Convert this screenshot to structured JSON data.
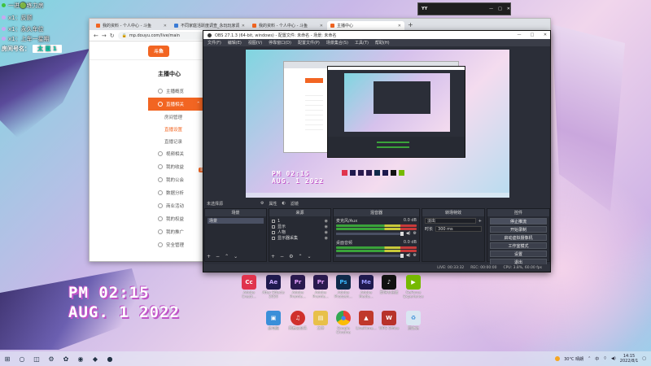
{
  "overlay": {
    "lines": [
      {
        "text": "一进🟢练力房",
        "dot": "#3fc23f"
      },
      {
        "text": "x1：反顾",
        "dot": ""
      },
      {
        "text": "x1：永久车位",
        "dot": ""
      },
      {
        "text": "x1：上车一星期",
        "dot": ""
      }
    ],
    "room_label": "房间号名：",
    "room_value": "太 鼠 1"
  },
  "stamp": {
    "time": "PM 02:15",
    "date": "AUG. 1 2022"
  },
  "browser": {
    "tabs": [
      {
        "label": "我的资料 - 个人中心 - 斗鱼",
        "close": "✕"
      },
      {
        "label": "不同家庭活跃度调查_永玩玩家调查",
        "close": "✕"
      },
      {
        "label": "我的资料 - 个人中心 - 斗鱼",
        "close": "✕"
      },
      {
        "label": "主播中心",
        "close": "✕"
      }
    ],
    "new_tab": "+",
    "url": "mp.douyu.com/live/main",
    "logo": "斗鱼",
    "home_tab": "首页",
    "sidebar_title": "主播中心",
    "sidebar": [
      {
        "label": "主播概览",
        "active": false
      },
      {
        "label": "直播相关",
        "active": true
      }
    ],
    "sub_items": [
      {
        "label": "房间管理",
        "active": false
      },
      {
        "label": "直播设置",
        "active": true
      },
      {
        "label": "直播记录",
        "active": false
      }
    ],
    "sidebar_more": [
      "视频相关",
      "我的收益",
      "我的公会",
      "数据分析",
      "商业活动",
      "我的权益",
      "我的推广",
      "安全管理"
    ],
    "badge": "新"
  },
  "obs": {
    "title": "OBS 27.1.3 (64-bit, windows) - 配置文件: 未命名 - 场景: 未命名",
    "menu": [
      "文件(F)",
      "编辑(E)",
      "视图(V)",
      "停靠窗口(D)",
      "配置文件(P)",
      "场景集合(S)",
      "工具(T)",
      "帮助(H)"
    ],
    "controls_bar": [
      "未选择源",
      "属性",
      "滤镜"
    ],
    "scenes_header": "场景",
    "scenes": [
      "场景"
    ],
    "sources_header": "来源",
    "sources": [
      "1",
      "显示",
      "人物",
      "显示器采集"
    ],
    "mixer_header": "混音器",
    "mixer": [
      {
        "name": "麦克风/Aux",
        "db": "0.0 dB"
      },
      {
        "name": "桌面音频",
        "db": "0.0 dB"
      }
    ],
    "transitions_header": "转场特效",
    "transition_type": "淡出",
    "duration_label": "时长",
    "duration_value": "300 ms",
    "controls_header": "控件",
    "controls": [
      "停止推流",
      "开始录制",
      "启动虚拟摄像机",
      "工作室模式",
      "设置",
      "退出"
    ],
    "status": [
      "LIVE: 00:33:32",
      "REC: 00:00:00",
      "CPU: 3.8%, 60.00 fps"
    ]
  },
  "mini_app": {
    "title": "YY",
    "buttons": [
      "—",
      "□",
      "✕"
    ]
  },
  "desktop_icons": [
    {
      "name": "Adobe Creati...",
      "abbr": "Cc",
      "color": "#e0334d"
    },
    {
      "name": "After Effects 2020",
      "abbr": "Ae",
      "color": "#1f1a4e"
    },
    {
      "name": "Adobe Premie...",
      "abbr": "Pr",
      "color": "#2a1a4e"
    },
    {
      "name": "Adobe Premie...",
      "abbr": "Pr",
      "color": "#2a1a4e"
    },
    {
      "name": "Adobe Photosh...",
      "abbr": "Ps",
      "color": "#0f2a4a"
    },
    {
      "name": "Adobe Media...",
      "abbr": "Me",
      "color": "#1f1a4e"
    },
    {
      "name": "剪映专业版",
      "abbr": "♪",
      "color": "#111111"
    },
    {
      "name": "GeForce Experience",
      "abbr": "▶",
      "color": "#76b900"
    },
    {
      "name": "此电脑",
      "abbr": "▣",
      "color": "#3a8fd9"
    },
    {
      "name": "网易云音乐",
      "abbr": "♫",
      "color": "#d0302c"
    },
    {
      "name": "文件",
      "abbr": "▤",
      "color": "#e8c04a"
    },
    {
      "name": "Google Chrome",
      "abbr": "●",
      "color": "#e9e9e9"
    },
    {
      "name": "LiveHime...",
      "abbr": "▲",
      "color": "#c0392b"
    },
    {
      "name": "WPS Office",
      "abbr": "W",
      "color": "#b8322a"
    },
    {
      "name": "回收站",
      "abbr": "♻",
      "color": "#d9e6f2"
    }
  ],
  "taskbar": {
    "start_icon": "⊞",
    "apps": [
      "○",
      "◫",
      "⚙",
      "✿",
      "◉",
      "◆",
      "●"
    ],
    "tray": {
      "weather": "30°C 晴朗",
      "lang": "中",
      "time": "14:15",
      "date": "2022/8/1"
    }
  }
}
